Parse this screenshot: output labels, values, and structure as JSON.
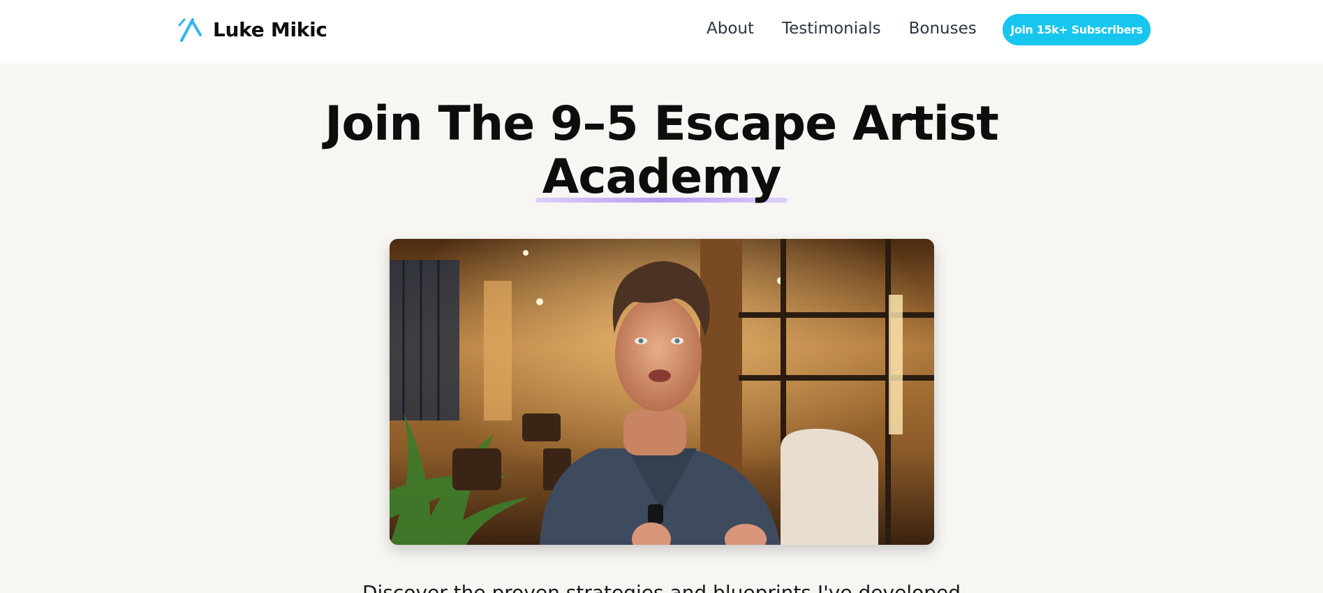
{
  "brand": {
    "name": "Luke Mikic",
    "logo_icon": "crossed-tools-icon",
    "logo_color": "#29b6f6"
  },
  "nav": {
    "links": [
      "About",
      "Testimonials",
      "Bonuses"
    ],
    "cta_label": "Join 15k+ Subscribers",
    "cta_color": "#16c6ee"
  },
  "hero": {
    "title_line1": "Join The 9–5 Escape Artist",
    "title_line2": "Academy",
    "underline_color": "#b89cf0",
    "video": {
      "thumbnail_icon": "video-thumbnail-presenter-icon"
    },
    "intro_text": "Discover the proven strategies and blueprints I've developed"
  },
  "colors": {
    "page_background": "#f7f6f3",
    "header_background": "#ffffff",
    "text": "#0d0d0d",
    "nav_text": "#2b3445"
  }
}
